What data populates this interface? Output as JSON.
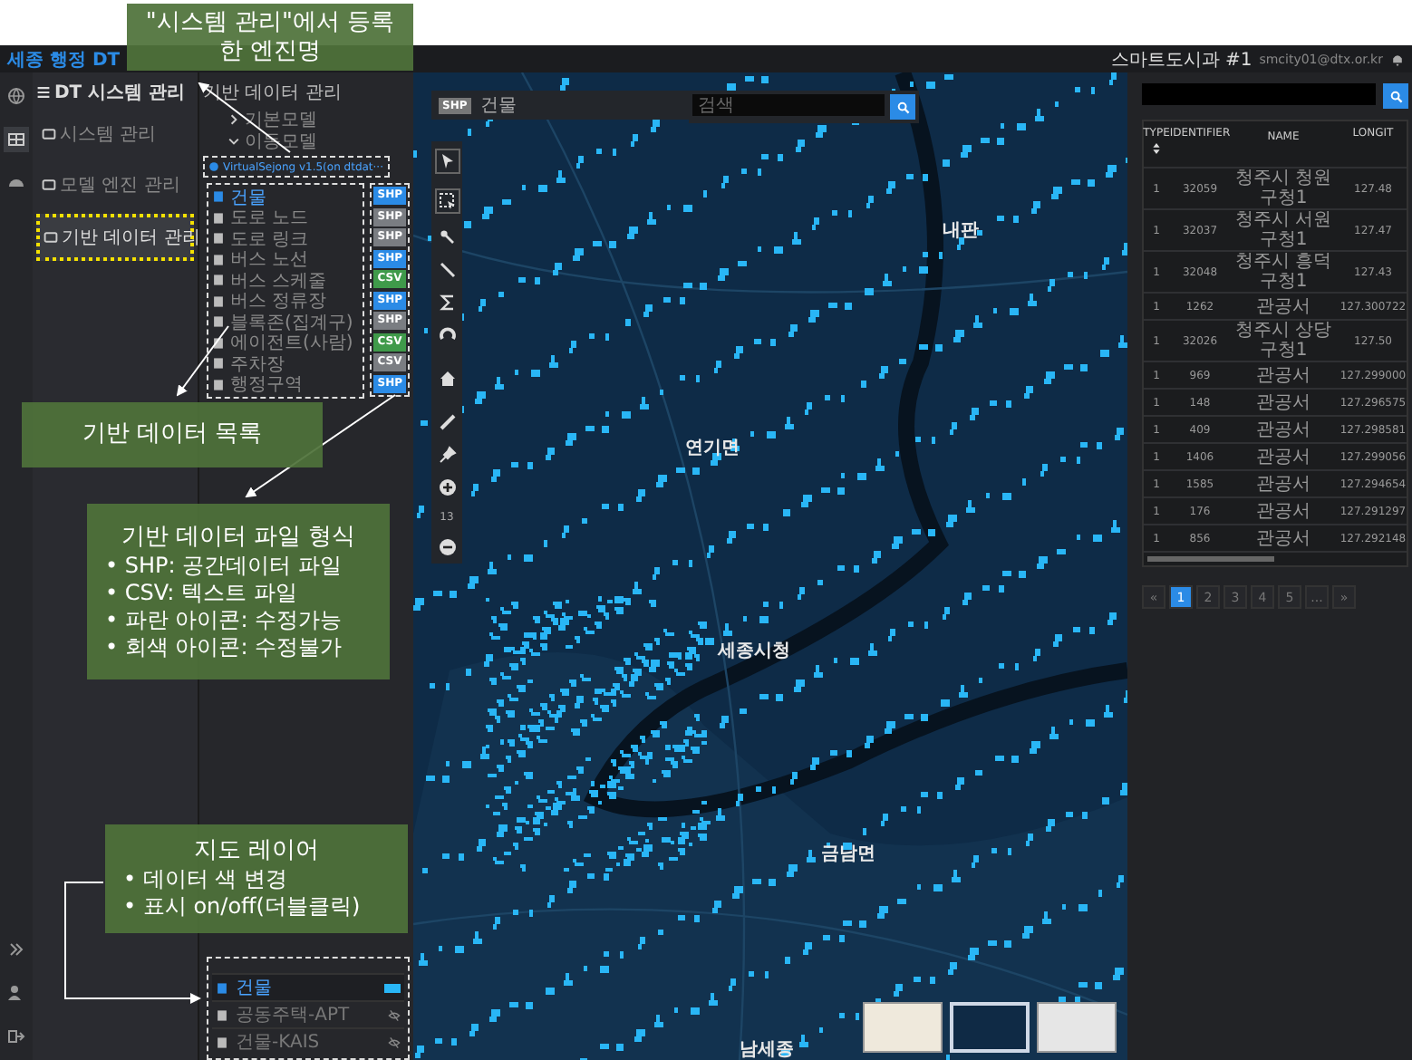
{
  "header": {
    "logo": "세종 행정 DT",
    "department": "스마트도시과 #1",
    "email": "smcity01@dtx.or.kr"
  },
  "nav": {
    "title": "DT 시스템 관리",
    "items": [
      {
        "label": "시스템 관리",
        "selected": false
      },
      {
        "label": "모델 엔진 관리",
        "selected": false
      },
      {
        "label": "기반 데이터 관리",
        "selected": true
      }
    ]
  },
  "data_panel": {
    "title": "기반 데이터 관리",
    "tree": [
      {
        "label": "기본모델",
        "expanded": false
      },
      {
        "label": "이동모델",
        "expanded": true
      }
    ],
    "engine": "VirtualSejong v1.5(on dtdat···",
    "items": [
      {
        "name": "건물",
        "format": "SHP",
        "editable": true,
        "selected": true
      },
      {
        "name": "도로 노드",
        "format": "SHP",
        "editable": false,
        "selected": false
      },
      {
        "name": "도로 링크",
        "format": "SHP",
        "editable": false,
        "selected": false
      },
      {
        "name": "버스 노선",
        "format": "SHP",
        "editable": true,
        "selected": false
      },
      {
        "name": "버스 스케줄",
        "format": "CSV",
        "editable": true,
        "selected": false
      },
      {
        "name": "버스 정류장",
        "format": "SHP",
        "editable": true,
        "selected": false
      },
      {
        "name": "블록존(집계구)",
        "format": "SHP",
        "editable": false,
        "selected": false
      },
      {
        "name": "에이전트(사람)",
        "format": "CSV",
        "editable": true,
        "selected": false
      },
      {
        "name": "주차장",
        "format": "CSV",
        "editable": false,
        "selected": false
      },
      {
        "name": "행정구역",
        "format": "SHP",
        "editable": true,
        "selected": false
      }
    ],
    "layers": [
      {
        "name": "건물",
        "selected": true,
        "visible": true,
        "color": "#29b6f6"
      },
      {
        "name": "공동주택-APT",
        "selected": false,
        "visible": false
      },
      {
        "name": "건물-KAIS",
        "selected": false,
        "visible": false
      }
    ]
  },
  "map": {
    "layer_chip": {
      "format": "SHP",
      "name": "건물"
    },
    "search": {
      "placeholder": "검색"
    },
    "zoom_level": "13",
    "labels": [
      "내판",
      "연기면",
      "세종시청",
      "금남면",
      "남세종"
    ],
    "basemaps": [
      {
        "kind": "light",
        "selected": false
      },
      {
        "kind": "dark",
        "selected": true
      },
      {
        "kind": "gray",
        "selected": false
      }
    ]
  },
  "results": {
    "columns": [
      "TYPE",
      "IDENTIFIER",
      "NAME",
      "LONGIT"
    ],
    "rows": [
      [
        "1",
        "32059",
        "청주시 청원구청1",
        "127.48"
      ],
      [
        "1",
        "32037",
        "청주시 서원구청1",
        "127.47"
      ],
      [
        "1",
        "32048",
        "청주시 흥덕구청1",
        "127.43"
      ],
      [
        "1",
        "1262",
        "관공서",
        "127.300722"
      ],
      [
        "1",
        "32026",
        "청주시 상당구청1",
        "127.50"
      ],
      [
        "1",
        "969",
        "관공서",
        "127.299000"
      ],
      [
        "1",
        "148",
        "관공서",
        "127.296575"
      ],
      [
        "1",
        "409",
        "관공서",
        "127.298581"
      ],
      [
        "1",
        "1406",
        "관공서",
        "127.299056"
      ],
      [
        "1",
        "1585",
        "관공서",
        "127.294654"
      ],
      [
        "1",
        "176",
        "관공서",
        "127.291297"
      ],
      [
        "1",
        "856",
        "관공서",
        "127.292148"
      ]
    ],
    "pagination": {
      "prev": "«",
      "next": "»",
      "pages": [
        {
          "label": "1",
          "selected": true
        },
        {
          "label": "2",
          "selected": false
        },
        {
          "label": "3",
          "selected": false
        },
        {
          "label": "4",
          "selected": false
        },
        {
          "label": "5",
          "selected": false
        },
        {
          "label": "...",
          "selected": false
        }
      ]
    }
  },
  "annotations": [
    {
      "lines": [
        "\"시스템 관리\"에서 등록",
        "한 엔진명"
      ]
    },
    {
      "lines": [
        "기반 데이터 목록"
      ]
    },
    {
      "lines": [
        "기반 데이터 파일 형식"
      ],
      "bullets": [
        "• SHP: 공간데이터 파일",
        "• CSV: 텍스트 파일",
        "• 파란 아이콘: 수정가능",
        "• 회색 아이콘: 수정불가"
      ]
    },
    {
      "lines": [
        "지도 레이어"
      ],
      "bullets": [
        "• 데이터 색 변경",
        "• 표시 on/off(더블클릭)"
      ]
    }
  ]
}
